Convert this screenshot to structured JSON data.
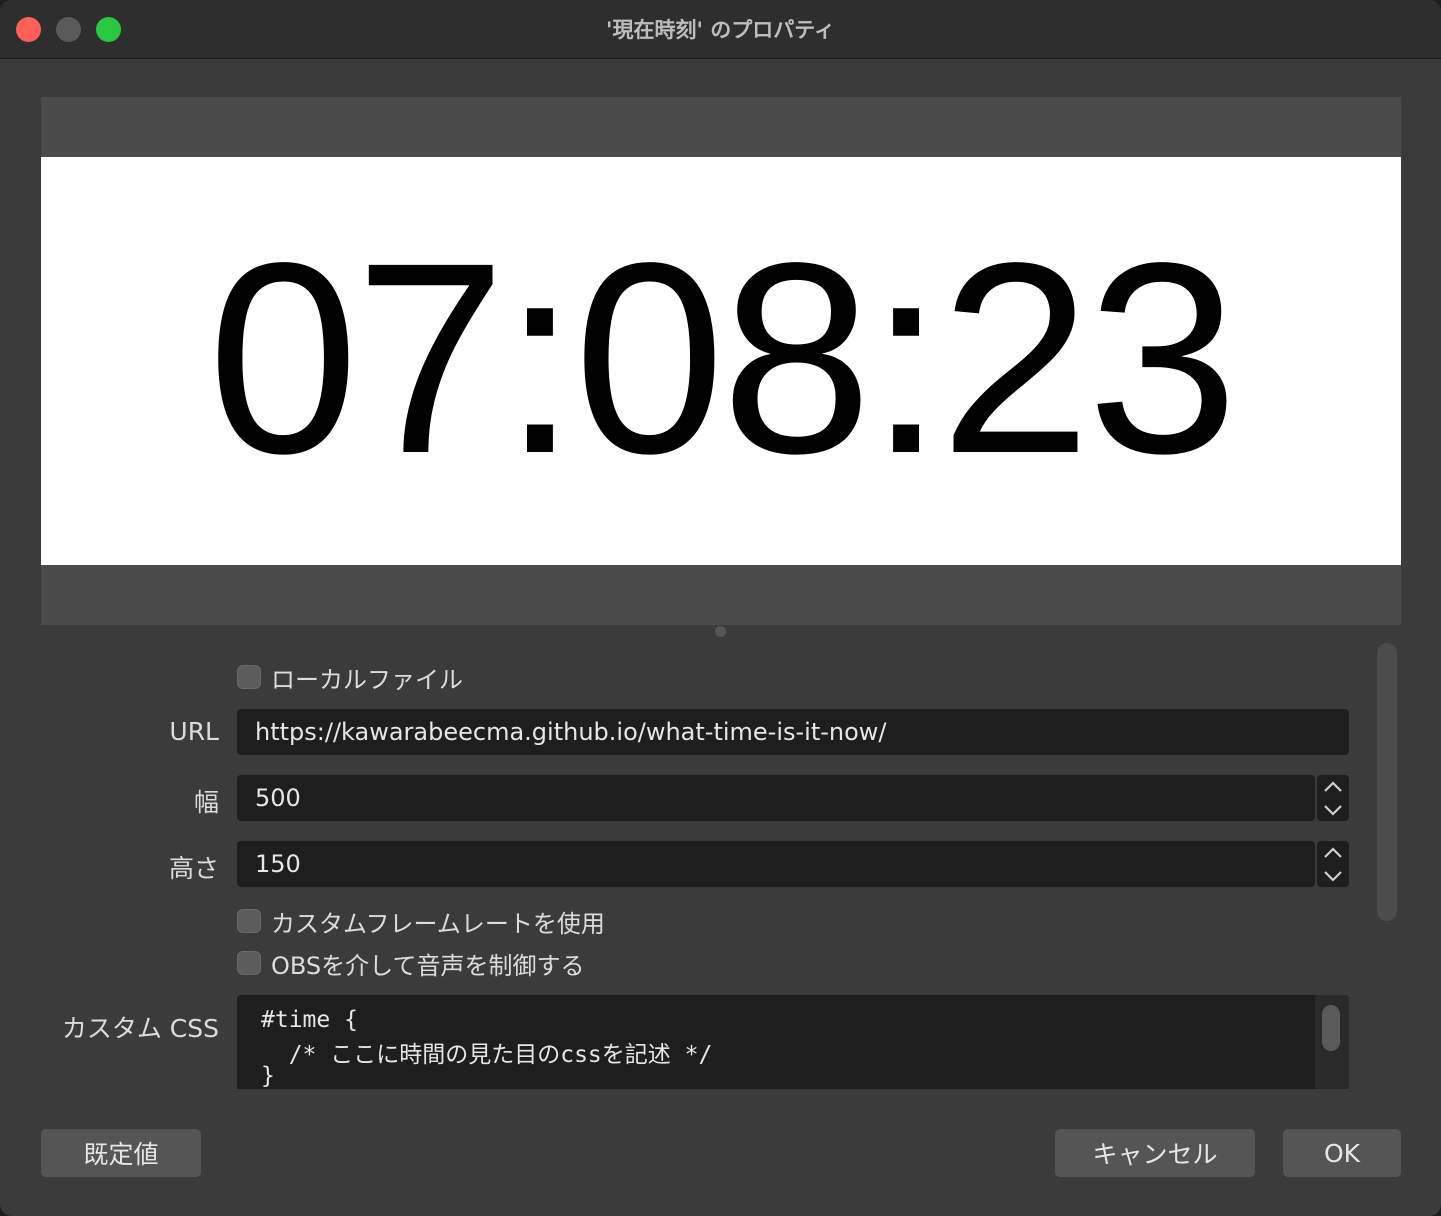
{
  "window": {
    "title": "'現在時刻' のプロパティ"
  },
  "preview": {
    "time_text": "07:08:23"
  },
  "form": {
    "local_file_label": "ローカルファイル",
    "url_label": "URL",
    "url_value": "https://kawarabeecma.github.io/what-time-is-it-now/",
    "width_label": "幅",
    "width_value": "500",
    "height_label": "高さ",
    "height_value": "150",
    "custom_fps_label": "カスタムフレームレートを使用",
    "obs_audio_label": "OBSを介して音声を制御する",
    "custom_css_label": "カスタム CSS",
    "css_lines": [
      "#time {",
      "  /* ここに時間の見た目のcssを記述 */",
      "}"
    ]
  },
  "buttons": {
    "defaults": "既定値",
    "cancel": "キャンセル",
    "ok": "OK"
  },
  "icons": {
    "close": "close-icon",
    "minimize": "minimize-icon",
    "maximize": "maximize-icon",
    "chevron_up": "chevron-up-icon",
    "chevron_down": "chevron-down-icon"
  },
  "colors": {
    "window_bg": "#3b3b3b",
    "input_bg": "#1e1e1e",
    "close": "#fe5f57",
    "maximize": "#28c840"
  }
}
